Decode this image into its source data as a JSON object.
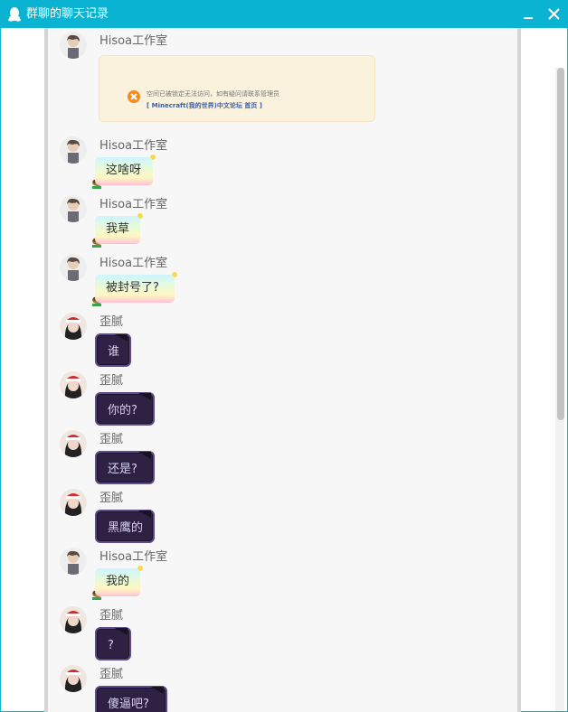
{
  "window": {
    "title": "群聊的聊天记录"
  },
  "notice": {
    "text": "空间已被锁定无法访问，如有疑问请联系管理员",
    "link": "[ Minecraft(我的世界)中文论坛 首页 ]"
  },
  "messages": [
    {
      "sender": "Hisoa工作室",
      "text": "这啥呀",
      "style": "rainbow"
    },
    {
      "sender": "Hisoa工作室",
      "text": "我草",
      "style": "rainbow"
    },
    {
      "sender": "Hisoa工作室",
      "text": "被封号了?",
      "style": "rainbow"
    },
    {
      "sender": "歪腻",
      "text": "谁",
      "style": "dark"
    },
    {
      "sender": "歪腻",
      "text": "你的?",
      "style": "dark"
    },
    {
      "sender": "歪腻",
      "text": "还是?",
      "style": "dark"
    },
    {
      "sender": "歪腻",
      "text": "黑鹰的",
      "style": "dark"
    },
    {
      "sender": "Hisoa工作室",
      "text": "我的",
      "style": "rainbow"
    },
    {
      "sender": "歪腻",
      "text": "?",
      "style": "dark"
    },
    {
      "sender": "歪腻",
      "text": "傻逼吧?",
      "style": "dark"
    }
  ],
  "first_sender": "Hisoa工作室",
  "colors": {
    "titlebar": "#0bb3d2",
    "dark_bubble": "#2f2143",
    "notice_bg": "#fbf2dd"
  },
  "icons": {
    "app": "qq-penguin-icon",
    "minimize": "minimize-icon",
    "close": "close-icon",
    "warning": "warning-icon"
  }
}
